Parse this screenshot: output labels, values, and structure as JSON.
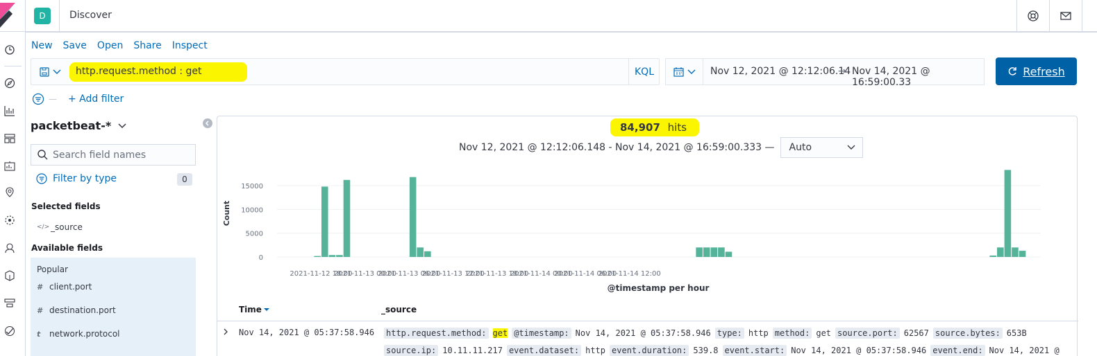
{
  "header": {
    "space_initial": "D",
    "title": "Discover"
  },
  "top_nav": {
    "new": "New",
    "save": "Save",
    "open": "Open",
    "share": "Share",
    "inspect": "Inspect"
  },
  "query": {
    "text": "http.request.method : get",
    "language": "KQL"
  },
  "date_range": {
    "start": "Nov 12, 2021 @ 12:12:06.14",
    "arrow": "→",
    "end": "Nov 14, 2021 @ 16:59:00.33"
  },
  "refresh_label": "Refresh",
  "filters": {
    "add_filter": "+ Add filter"
  },
  "sidebar": {
    "index_pattern": "packetbeat-*",
    "search_placeholder": "Search field names",
    "filter_by_type": "Filter by type",
    "filter_count": "0",
    "selected_title": "Selected fields",
    "selected_fields": [
      {
        "type": "</>",
        "name": "_source"
      }
    ],
    "available_title": "Available fields",
    "popular_title": "Popular",
    "popular_fields": [
      {
        "type": "#",
        "name": "client.port"
      },
      {
        "type": "#",
        "name": "destination.port"
      },
      {
        "type": "t",
        "name": "network.protocol"
      }
    ]
  },
  "results": {
    "hits_count": "84,907",
    "hits_label": "hits",
    "range_text": "Nov 12, 2021 @ 12:12:06.148 - Nov 14, 2021 @ 16:59:00.333 —",
    "interval": "Auto"
  },
  "chart_data": {
    "type": "bar",
    "xlabel": "@timestamp per hour",
    "ylabel": "Count",
    "ylim": [
      0,
      18500
    ],
    "yticks": [
      0,
      5000,
      10000,
      15000
    ],
    "xticks": [
      "2021-11-12 18:00",
      "2021-11-13 00:00",
      "2021-11-13 06:00",
      "2021-11-13 12:00",
      "2021-11-13 18:00",
      "2021-11-14 00:00",
      "2021-11-14 06:00",
      "2021-11-14 12:00"
    ],
    "x_start": "2021-11-12 12:00",
    "x_step_hours": 1,
    "values": [
      0,
      0,
      0,
      0,
      0,
      200,
      14800,
      400,
      400,
      16200,
      0,
      0,
      0,
      0,
      0,
      0,
      0,
      0,
      16800,
      2000,
      1200,
      0,
      0,
      0,
      0,
      0,
      0,
      0,
      0,
      0,
      0,
      0,
      0,
      0,
      0,
      0,
      0,
      0,
      0,
      0,
      0,
      0,
      0,
      0,
      0,
      0,
      0,
      0,
      0,
      0,
      0,
      0,
      0,
      0,
      0,
      0,
      0,
      2000,
      2000,
      2000,
      2000,
      1100,
      0,
      0,
      0,
      0,
      0,
      0,
      0,
      0,
      0,
      0,
      0,
      0,
      0,
      0,
      0,
      0,
      0,
      0,
      0,
      0,
      0,
      0,
      0,
      0,
      0,
      0,
      0,
      0,
      0,
      0,
      0,
      0,
      0,
      0,
      0,
      300,
      2000,
      18300,
      2000,
      1300,
      0,
      0
    ],
    "color": "#54b399"
  },
  "table": {
    "col_time": "Time",
    "col_source": "_source",
    "row_time": "Nov 14, 2021 @ 05:37:58.946",
    "fields": [
      {
        "k": "http.request.method:",
        "v": "get",
        "highlight": true
      },
      {
        "k": "@timestamp:",
        "v": "Nov 14, 2021 @ 05:37:58.946"
      },
      {
        "k": "type:",
        "v": "http"
      },
      {
        "k": "method:",
        "v": "get"
      },
      {
        "k": "source.port:",
        "v": "62567"
      },
      {
        "k": "source.bytes:",
        "v": "653B"
      }
    ],
    "fields_line2": [
      {
        "k": "source.ip:",
        "v": "10.11.11.217"
      },
      {
        "k": "event.dataset:",
        "v": "http"
      },
      {
        "k": "event.duration:",
        "v": "539.8"
      },
      {
        "k": "event.start:",
        "v": "Nov 14, 2021 @ 05:37:58.946"
      },
      {
        "k": "event.end:",
        "v": "Nov 14, 2021 @"
      }
    ]
  },
  "colors": {
    "accent": "#006bb8",
    "refresh_bg": "#0061a6",
    "bar": "#54b399",
    "highlight": "#fbf600"
  }
}
